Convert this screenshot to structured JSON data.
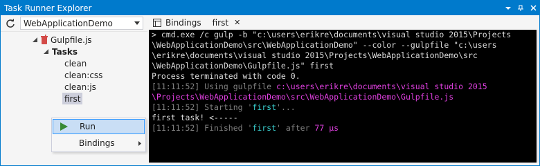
{
  "window": {
    "title": "Task Runner Explorer"
  },
  "left": {
    "project_select": "WebApplicationDemo",
    "tree": {
      "file": "Gulpfile.js",
      "group": "Tasks",
      "tasks": [
        "clean",
        "clean:css",
        "clean:js",
        "first"
      ]
    }
  },
  "menu": {
    "run": "Run",
    "bindings": "Bindings"
  },
  "tabs": [
    {
      "label": "Bindings"
    },
    {
      "label": "first"
    }
  ],
  "console": {
    "lines": [
      [
        {
          "t": "> cmd.exe /c gulp -b \"c:\\users\\erikre\\documents\\visual studio 2015\\Projects",
          "c": "white"
        }
      ],
      [
        {
          "t": "\\WebApplicationDemo\\src\\WebApplicationDemo\" --color --gulpfile \"c:\\users",
          "c": "white"
        }
      ],
      [
        {
          "t": "\\erikre\\documents\\visual studio 2015\\Projects\\WebApplicationDemo\\src",
          "c": "white"
        }
      ],
      [
        {
          "t": "\\WebApplicationDemo\\Gulpfile.js\" first",
          "c": "white"
        }
      ],
      [
        {
          "t": "Process terminated with code 0.",
          "c": "white"
        }
      ],
      [
        {
          "t": "[11:11:52] Using gulpfile ",
          "c": "gray"
        },
        {
          "t": "c:\\users\\erikre\\documents\\visual studio 2015",
          "c": "mag"
        }
      ],
      [
        {
          "t": "\\Projects\\WebApplicationDemo\\src\\WebApplicationDemo\\Gulpfile.js",
          "c": "mag"
        }
      ],
      [
        {
          "t": "[11:11:52] Starting '",
          "c": "gray"
        },
        {
          "t": "first",
          "c": "cyan"
        },
        {
          "t": "'...",
          "c": "gray"
        }
      ],
      [
        {
          "t": "first task! <-----",
          "c": "white"
        }
      ],
      [
        {
          "t": "[11:11:52] Finished '",
          "c": "gray"
        },
        {
          "t": "first",
          "c": "cyan"
        },
        {
          "t": "' after ",
          "c": "gray"
        },
        {
          "t": "77 μs",
          "c": "mag"
        }
      ]
    ]
  },
  "colors": {
    "accent": "#007acc",
    "console_bg": "#000000",
    "magenta": "#e040e0",
    "cyan": "#3ad3d3",
    "gray": "#808080",
    "run_green": "#388a34",
    "gulp_red": "#d34a47"
  },
  "icons": [
    "dropdown-icon",
    "pin-icon",
    "close-icon",
    "refresh-icon",
    "gulp-icon",
    "play-icon",
    "submenu-arrow-icon",
    "bindings-icon"
  ]
}
